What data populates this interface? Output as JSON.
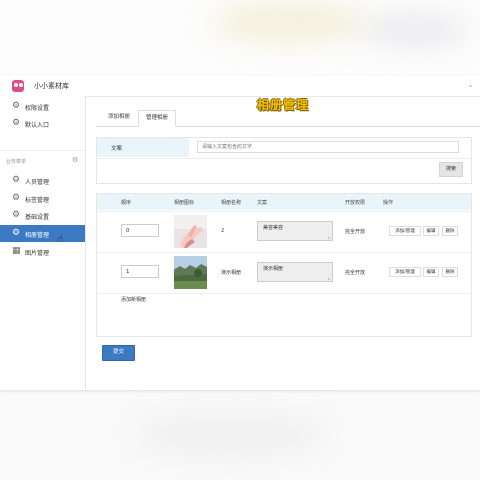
{
  "app": {
    "title": "小小素材库"
  },
  "sidebar": {
    "top_items": [
      {
        "label": "权限设置",
        "icon": "gear-icon"
      },
      {
        "label": "默认入口",
        "icon": "gear-icon"
      }
    ],
    "section_label": "业务菜单",
    "items": [
      {
        "label": "人员管理",
        "icon": "gear-icon"
      },
      {
        "label": "标签管理",
        "icon": "gear-icon"
      },
      {
        "label": "基础设置",
        "icon": "gear-icon"
      },
      {
        "label": "相册管理",
        "icon": "gear-icon",
        "active": true
      },
      {
        "label": "图片管理",
        "icon": "grid-icon"
      }
    ]
  },
  "main": {
    "page_title": "相册管理",
    "tabs": [
      {
        "label": "添加相册"
      },
      {
        "label": "管理相册",
        "active": true
      }
    ],
    "search": {
      "label": "文案",
      "placeholder": "请输入文案包含的文字",
      "button": "搜索"
    },
    "table": {
      "headers": [
        "顺序",
        "相册图标",
        "相册名称",
        "文案",
        "开放权限",
        "操作"
      ],
      "rows": [
        {
          "order": "0",
          "name": "2",
          "caption": "美容美容",
          "permission": "完全开放",
          "actions": [
            "添加/管理",
            "编辑",
            "删除"
          ]
        },
        {
          "order": "1",
          "name": "演示相册",
          "caption": "演示相册",
          "permission": "完全开放",
          "actions": [
            "添加/管理",
            "编辑",
            "删除"
          ]
        }
      ],
      "add_row": "添加新相册"
    },
    "submit": "提交"
  },
  "colors": {
    "accent": "#3b79c2",
    "title_yellow": "#f2c200",
    "header_bg": "#eaf5fb"
  }
}
